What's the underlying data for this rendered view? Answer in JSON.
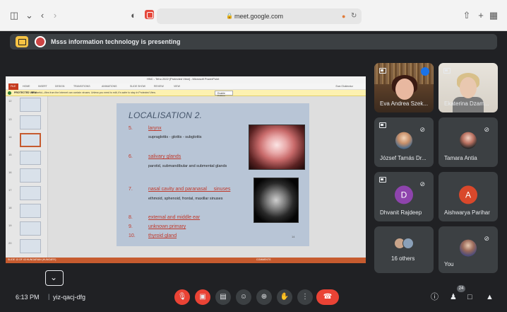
{
  "browser": {
    "url": "meet.google.com",
    "icons": [
      "sidebar-icon",
      "back-icon",
      "forward-icon",
      "privacy-icon",
      "lock-icon",
      "share-icon",
      "new-tab-icon",
      "tab-overview-icon"
    ]
  },
  "banner": {
    "text": "Msss information technology is presenting"
  },
  "presentation": {
    "window_title": "HNC - Teho 2022 [Protected View] - Microsoft PowerPoint",
    "ribbon_tabs": [
      "FILE",
      "HOME",
      "INSERT",
      "DESIGN",
      "TRANSITIONS",
      "ANIMATIONS",
      "SLIDE SHOW",
      "REVIEW",
      "VIEW"
    ],
    "user": "Ewa Olukiewicz",
    "protected_view": {
      "label": "PROTECTED VIEW",
      "message": "Be careful—files from the Internet can contain viruses. Unless you need to edit, it's safer to stay in Protected View.",
      "button": "Enable Editing"
    },
    "thumbnail_numbers": [
      "12",
      "13",
      "14",
      "15",
      "16",
      "17",
      "18",
      "19",
      "20"
    ],
    "slide": {
      "title": "LOCALISATION 2.",
      "items": [
        {
          "num": "5.",
          "head": "larynx",
          "sub": "supraglottis - glottis - subglottis"
        },
        {
          "num": "6.",
          "head": "salivary glands",
          "sub": "parotid, submandibular and submental glands"
        },
        {
          "num": "7.",
          "head": "nasal cavity and paranasal     sinuses",
          "sub": "ethmoid, sphenoid, frontal, maxillar sinuses"
        },
        {
          "num": "8.",
          "head": "external and middle ear",
          "sub": ""
        },
        {
          "num": "9.",
          "head": "unknown primary",
          "sub": ""
        },
        {
          "num": "10.",
          "head": "thyroid gland",
          "sub": ""
        }
      ],
      "page_number": "14"
    },
    "status": {
      "left": "SLIDE 13 OF 43    HUNGARIAN (HUNGARY)",
      "comments": "COMMENTS"
    }
  },
  "participants": [
    {
      "name": "Eva Andrea Szek...",
      "muted": false,
      "speaking": true
    },
    {
      "name": "Ekaterina Dzam...",
      "muted": false
    },
    {
      "name": "József Tamás Dr...",
      "muted": true
    },
    {
      "name": "Tamara Antia",
      "muted": true
    },
    {
      "name": "Dhvanit Rajdeep",
      "muted": true,
      "initial": "D",
      "color": "#8e44ad"
    },
    {
      "name": "Aishwarya Parihar",
      "muted": false,
      "initial": "A",
      "color": "#d9482b"
    },
    {
      "name": "16 others"
    },
    {
      "name": "You",
      "muted": true
    }
  ],
  "meeting": {
    "time": "6:13 PM",
    "code": "yiz-qacj-dfg",
    "people_count": "24"
  },
  "controls": {
    "mic": "mic-off-icon",
    "camera": "camera-off-icon",
    "captions": "captions-icon",
    "emoji": "emoji-icon",
    "present": "present-icon",
    "hand": "raise-hand-icon",
    "more": "more-options-icon",
    "end": "end-call-icon"
  }
}
